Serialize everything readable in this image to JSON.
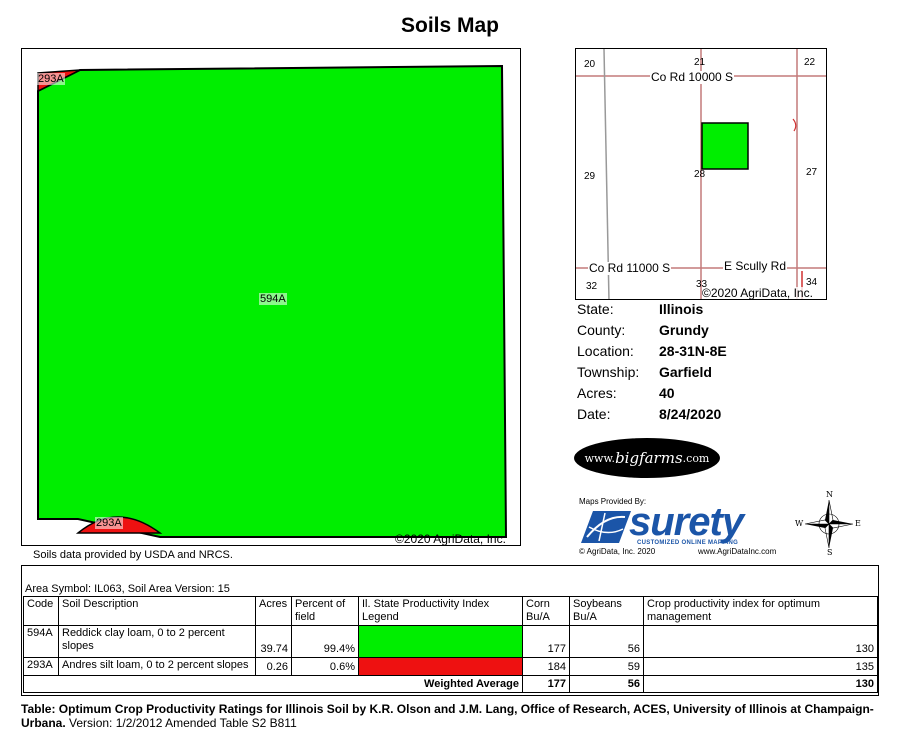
{
  "title": "Soils Map",
  "map": {
    "main_soil_label": "594A",
    "minor_soil_label_top": "293A",
    "minor_soil_label_bottom": "293A",
    "copyright": "©2020 AgriData, Inc.",
    "colors": {
      "main_soil": "#00ee00",
      "minor_soil": "#ee1111"
    }
  },
  "data_note": "Soils data provided by USDA and NRCS.",
  "location_map": {
    "roads": [
      "Co Rd 10000 S",
      "Co Rd 11000 S",
      "E Scully Rd"
    ],
    "sections": [
      "20",
      "21",
      "22",
      "29",
      "28",
      "27",
      "32",
      "33",
      "34"
    ],
    "copyright": "©2020 AgriData, Inc."
  },
  "info": {
    "state_label": "State:",
    "state_value": "Illinois",
    "county_label": "County:",
    "county_value": "Grundy",
    "location_label": "Location:",
    "location_value": "28-31N-8E",
    "township_label": "Township:",
    "township_value": "Garfield",
    "acres_label": "Acres:",
    "acres_value": "40",
    "date_label": "Date:",
    "date_value": "8/24/2020"
  },
  "branding": {
    "bigfarms_prefix": "www.",
    "bigfarms_script": "bigfarms",
    "bigfarms_suffix": ".com",
    "maps_provided_by": "Maps Provided By:",
    "surety_name": "surety",
    "surety_tagline": "CUSTOMIZED ONLINE MAPPING",
    "surety_copyright": "© AgriData, Inc. 2020",
    "surety_url": "www.AgriDataInc.com",
    "compass": {
      "n": "N",
      "e": "E",
      "s": "S",
      "w": "W"
    }
  },
  "table": {
    "area_symbol": "Area Symbol: IL063, Soil Area Version: 15",
    "headers": [
      "Code",
      "Soil Description",
      "Acres",
      "Percent of field",
      "Il. State Productivity Index Legend",
      "Corn Bu/A",
      "Soybeans Bu/A",
      "Crop productivity index for optimum management"
    ],
    "rows": [
      {
        "code": "594A",
        "description": "Reddick clay loam, 0 to 2 percent slopes",
        "acres": "39.74",
        "percent": "99.4%",
        "color": "#00ee00",
        "corn": "177",
        "soybeans": "56",
        "cpi": "130"
      },
      {
        "code": "293A",
        "description": "Andres silt loam, 0 to 2 percent slopes",
        "acres": "0.26",
        "percent": "0.6%",
        "color": "#ee1111",
        "corn": "184",
        "soybeans": "59",
        "cpi": "135"
      }
    ],
    "weighted": {
      "label": "Weighted Average",
      "corn": "177",
      "soybeans": "56",
      "cpi": "130"
    }
  },
  "footnote": {
    "bold_part": "Table: Optimum Crop Productivity Ratings for Illinois Soil by K.R. Olson and J.M. Lang, Office of Research, ACES, University of Illinois at Champaign-Urbana.",
    "normal_part": " Version: 1/2/2012 Amended Table S2 B811"
  }
}
